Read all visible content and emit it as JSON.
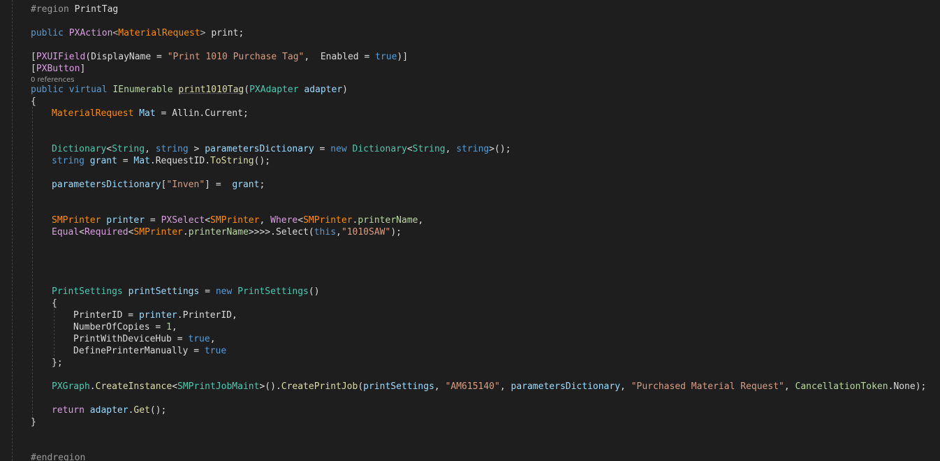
{
  "codelens": "0 references",
  "lines": {
    "l1_pre": "#region",
    "l1_name": "PrintTag",
    "l2_public": "public",
    "l2_type": "PXAction",
    "l2_lt": "<",
    "l2_gen": "MaterialRequest",
    "l2_gt": "> ",
    "l2_name": "print;",
    "l3_lb": "[",
    "l3_attr": "PXUIField",
    "l3_a": "(DisplayName = ",
    "l3_str": "\"Print 1010 Purchase Tag\"",
    "l3_b": ",  Enabled = ",
    "l3_true": "true",
    "l3_c": ")]",
    "l4_lb": "[",
    "l4_attr": "PXButton",
    "l4_rb": "]",
    "l5_public": "public",
    "l5_virtual": "virtual",
    "l5_type": "IEnumerable",
    "l5_name": "print1010Tag",
    "l5_lp": "(",
    "l5_ptype": "PXAdapter",
    "l5_pname": "adapter",
    "l5_rp": ")",
    "l6": "{",
    "l7_type": "MaterialRequest",
    "l7_var": "Mat",
    "l7_eq": " = ",
    "l7_obj": "Allin",
    "l7_dot": ".",
    "l7_prop": "Current",
    "l7_semi": ";",
    "l8_type": "Dictionary",
    "l8_lt": "<",
    "l8_t1": "String",
    "l8_comma": ", ",
    "l8_t2": "string",
    "l8_gt": " > ",
    "l8_var": "parametersDictionary",
    "l8_eq": " = ",
    "l8_new": "new",
    "l8_type2": "Dictionary",
    "l8_lt2": "<",
    "l8_t3": "String",
    "l8_comma2": ", ",
    "l8_t4": "string",
    "l8_end": ">();",
    "l9_type": "string",
    "l9_var": "grant",
    "l9_eq": " = ",
    "l9_obj": "Mat",
    "l9_dot": ".",
    "l9_prop": "RequestID",
    "l9_dot2": ".",
    "l9_m": "ToString",
    "l9_end": "();",
    "l10_var": "parametersDictionary",
    "l10_lb": "[",
    "l10_str": "\"Inven\"",
    "l10_rb": "] =  ",
    "l10_val": "grant",
    "l10_semi": ";",
    "l11_type": "SMPrinter",
    "l11_var": "printer",
    "l11_eq": " = ",
    "l11_sel": "PXSelect",
    "l11_lt": "<",
    "l11_t": "SMPrinter",
    "l11_comma": ", ",
    "l11_where": "Where",
    "l11_lt2": "<",
    "l11_t2": "SMPrinter",
    "l11_dot": ".",
    "l11_f": "printerName",
    "l11_comma2": ",",
    "l12_eq": "Equal",
    "l12_lt": "<",
    "l12_req": "Required",
    "l12_lt2": "<",
    "l12_t": "SMPrinter",
    "l12_dot": ".",
    "l12_f": "printerName",
    "l12_gts": ">>>>",
    "l12_dot2": ".",
    "l12_m": "Select",
    "l12_lp": "(",
    "l12_this": "this",
    "l12_comma": ",",
    "l12_str": "\"1010SAW\"",
    "l12_end": ");",
    "l13_type": "PrintSettings",
    "l13_var": "printSettings",
    "l13_eq": " = ",
    "l13_new": "new",
    "l13_type2": "PrintSettings",
    "l13_end": "()",
    "l14": "{",
    "l15_a": "PrinterID",
    "l15_eq": " = ",
    "l15_obj": "printer",
    "l15_dot": ".",
    "l15_p": "PrinterID",
    "l15_c": ",",
    "l16_a": "NumberOfCopies",
    "l16_eq": " = ",
    "l16_num": "1",
    "l16_c": ",",
    "l17_a": "PrintWithDeviceHub",
    "l17_eq": " = ",
    "l17_true": "true",
    "l17_c": ",",
    "l18_a": "DefinePrinterManually",
    "l18_eq": " = ",
    "l18_true": "true",
    "l19": "};",
    "l20_cls": "PXGraph",
    "l20_dot": ".",
    "l20_m": "CreateInstance",
    "l20_lt": "<",
    "l20_t": "SMPrintJobMaint",
    "l20_gt": ">().",
    "l20_m2": "CreatePrintJob",
    "l20_lp": "(",
    "l20_a1": "printSettings",
    "l20_c1": ", ",
    "l20_s1": "\"AM615140\"",
    "l20_c2": ", ",
    "l20_a2": "parametersDictionary",
    "l20_c3": ", ",
    "l20_s2": "\"Purchased Material Request\"",
    "l20_c4": ", ",
    "l20_t2": "CancellationToken",
    "l20_dot2": ".",
    "l20_p": "None",
    "l20_end": ");",
    "l21_ret": "return",
    "l21_obj": "adapter",
    "l21_dot": ".",
    "l21_m": "Get",
    "l21_end": "();",
    "l22": "}",
    "l23_pre": "#endregion"
  },
  "colors": {
    "background": "#1e1e1e",
    "keyword": "#569cd6",
    "class": "#4ec9b0",
    "string": "#d69d85",
    "method": "#dcdcaa"
  }
}
